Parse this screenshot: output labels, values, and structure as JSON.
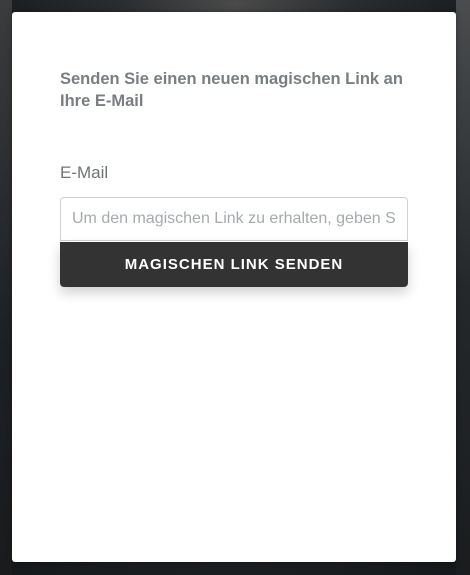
{
  "form": {
    "heading": "Senden Sie einen neuen magischen Link an Ihre E-Mail",
    "email_label": "E-Mail",
    "email_value": "",
    "email_placeholder": "Um den magischen Link zu erhalten, geben Sie Ihre E-Mail ein",
    "submit_label": "MAGISCHEN LINK SENDEN"
  },
  "colors": {
    "button_background": "#333333",
    "heading_text": "#7a7e82",
    "card_background": "#ffffff"
  }
}
